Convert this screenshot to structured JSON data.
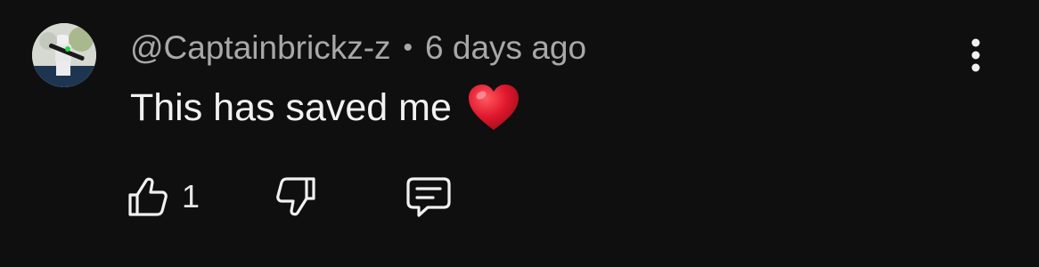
{
  "comment": {
    "author": "@Captainbrickz-z",
    "separator": "•",
    "time_ago": "6 days ago",
    "text": "This has saved me",
    "like_count": "1"
  },
  "icons": {
    "emoji": "red-heart",
    "like": "thumbs-up-icon",
    "dislike": "thumbs-down-icon",
    "reply": "comment-reply-icon",
    "menu": "more-vertical-icon"
  },
  "colors": {
    "background": "#0f0f0f",
    "meta_text": "#a8a8a8",
    "body_text": "#f1f1f1",
    "heart": "#e0182d"
  }
}
